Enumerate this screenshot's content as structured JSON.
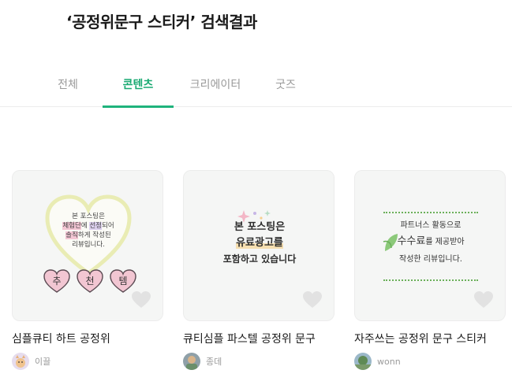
{
  "search": {
    "title": "‘공정위문구 스티커’ 검색결과"
  },
  "tabs": [
    {
      "label": "전체"
    },
    {
      "label": "콘텐츠"
    },
    {
      "label": "크리에이터"
    },
    {
      "label": "굿즈"
    }
  ],
  "cards": [
    {
      "title": "심플큐티 하트 공정위",
      "author": "이끌",
      "art": {
        "line1": "본 포스팅은",
        "line2a": "체험단",
        "line2b": "에 ",
        "line2c": "선정",
        "line2d": "되어",
        "line3a": "솔직",
        "line3b": "하게 작성된",
        "line4": "리뷰입니다.",
        "hearts": [
          "추",
          "천",
          "템"
        ]
      }
    },
    {
      "title": "큐티심플 파스텔 공정위 문구",
      "author": "종데",
      "art": {
        "line1": "본 포스팅은",
        "line2": "유료광고를",
        "line3": "포함하고 있습니다"
      }
    },
    {
      "title": "자주쓰는 공정위 문구 스티커",
      "author": "wonn",
      "art": {
        "line1": "파트너스 활동으로",
        "line2a": "수수료",
        "line2b": "를 제공받아",
        "line3": "작성한 리뷰입니다."
      }
    }
  ],
  "colors": {
    "accent": "#1fb37c",
    "tab_inactive": "#9a9a9a"
  }
}
